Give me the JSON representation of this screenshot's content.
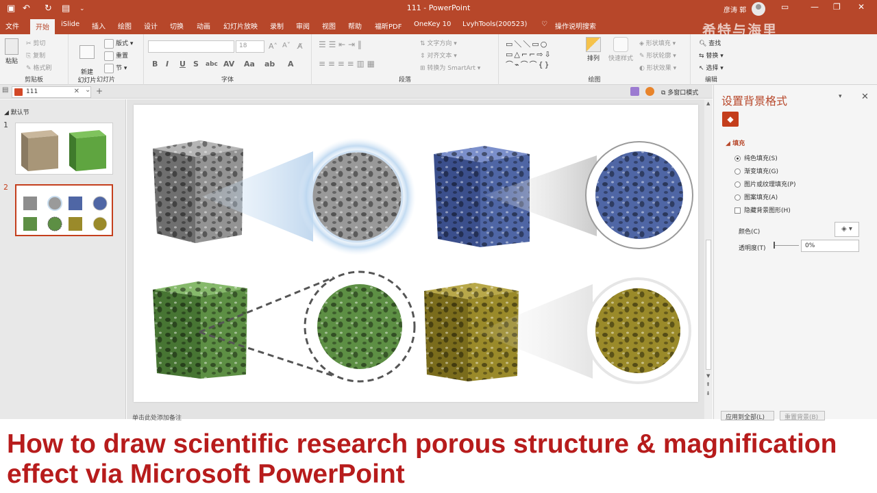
{
  "app": {
    "title": "111 - PowerPoint",
    "user": "彦涛 郭",
    "watermark": "希特与海里"
  },
  "tabs": [
    "文件",
    "开始",
    "iSlide",
    "插入",
    "绘图",
    "设计",
    "切换",
    "动画",
    "幻灯片放映",
    "录制",
    "审阅",
    "视图",
    "帮助",
    "福昕PDF",
    "OneKey 10",
    "LvyhTools(200523)",
    "操作说明搜索"
  ],
  "ribbon": {
    "clipboard": {
      "label": "剪贴板",
      "paste": "粘贴",
      "cut": "剪切",
      "copy": "复制",
      "painter": "格式刷"
    },
    "slides": {
      "label": "幻灯片",
      "new": "新建\n幻灯片",
      "layout": "版式",
      "reset": "重置",
      "section": "节"
    },
    "font": {
      "label": "字体",
      "size": "18"
    },
    "paragraph": {
      "label": "段落",
      "direction": "文字方向",
      "align": "对齐文本",
      "smartart": "转换为 SmartArt"
    },
    "drawing": {
      "label": "绘图",
      "arrange": "排列",
      "quickstyles": "快速样式",
      "fill": "形状填充",
      "outline": "形状轮廓",
      "effects": "形状效果"
    },
    "editing": {
      "label": "编辑",
      "find": "查找",
      "replace": "替换",
      "select": "选择"
    }
  },
  "doc_tab": {
    "name": "111",
    "multiwindow": "多窗口模式"
  },
  "thumbnails": {
    "section": "默认节",
    "slides": [
      {
        "num": "1"
      },
      {
        "num": "2"
      }
    ]
  },
  "notes_placeholder": "单击此处添加备注",
  "format_pane": {
    "title": "设置背景格式",
    "section": "填充",
    "options": [
      {
        "label": "纯色填充(S)",
        "selected": true
      },
      {
        "label": "渐变填充(G)",
        "selected": false
      },
      {
        "label": "图片或纹理填充(P)",
        "selected": false
      },
      {
        "label": "图案填充(A)",
        "selected": false
      }
    ],
    "hide_bg": "隐藏背景图形(H)",
    "color_label": "颜色(C)",
    "transparency_label": "透明度(T)",
    "transparency_value": "0%",
    "apply_all": "应用到全部(L)",
    "reset_bg": "重置背景(B)"
  },
  "caption": "How to draw scientific research porous structure & magnification effect via Microsoft PowerPoint",
  "colors": {
    "accent": "#b7472a",
    "gray_cube": "#8d8d8d",
    "blue_cube": "#4f66a5",
    "green_cube": "#5d8f44",
    "olive_cube": "#9a8a2a",
    "caption": "#b71c1c"
  }
}
